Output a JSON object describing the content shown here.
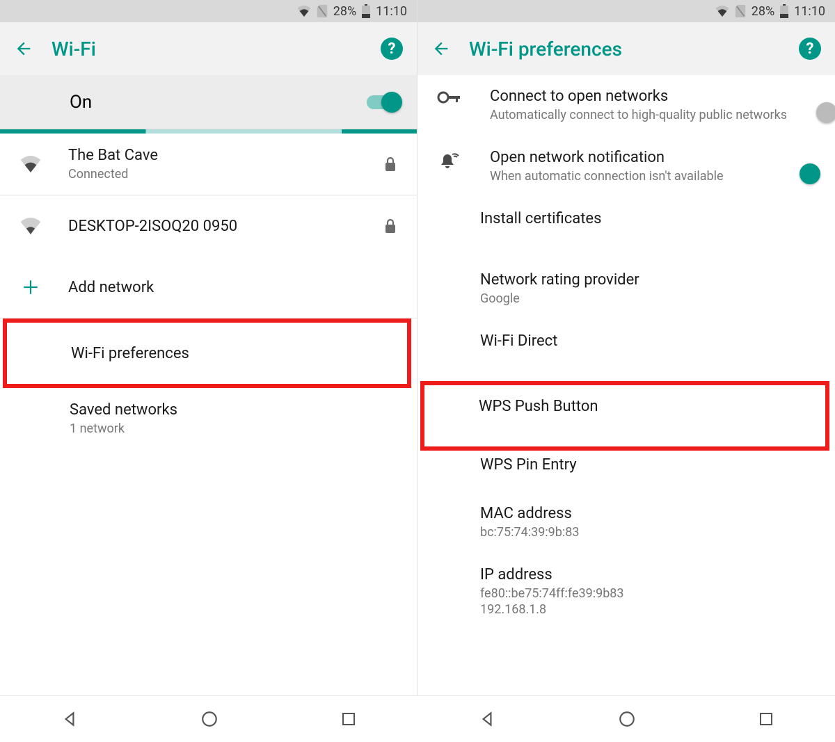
{
  "status": {
    "battery_percent": "28%",
    "time": "11:10"
  },
  "left": {
    "title": "Wi-Fi",
    "toggle_label": "On",
    "networks": [
      {
        "ssid": "The Bat Cave",
        "status": "Connected"
      },
      {
        "ssid": "DESKTOP-2ISOQ20 0950"
      }
    ],
    "add_network": "Add network",
    "wifi_prefs": "Wi-Fi preferences",
    "saved_networks": {
      "title": "Saved networks",
      "count": "1 network"
    }
  },
  "right": {
    "title": "Wi-Fi preferences",
    "items": {
      "open_conn": {
        "title": "Connect to open networks",
        "sub": "Automatically connect to high-quality public networks"
      },
      "open_notif": {
        "title": "Open network notification",
        "sub": "When automatic connection isn't available"
      },
      "install_certs": "Install certificates",
      "rating": {
        "title": "Network rating provider",
        "sub": "Google"
      },
      "wifi_direct": "Wi-Fi Direct",
      "wps_push": "WPS Push Button",
      "wps_pin": "WPS Pin Entry",
      "mac": {
        "title": "MAC address",
        "sub": "bc:75:74:39:9b:83"
      },
      "ip": {
        "title": "IP address",
        "sub1": "fe80::be75:74ff:fe39:9b83",
        "sub2": "192.168.1.8"
      }
    }
  }
}
